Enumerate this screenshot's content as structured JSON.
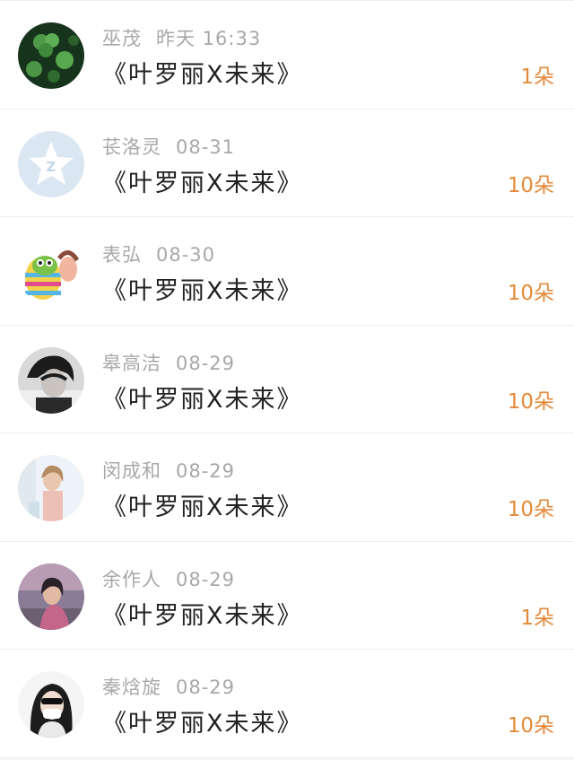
{
  "colors": {
    "count_accent": "#e38a3a",
    "meta_text": "#a8a8a8",
    "title_text": "#222222"
  },
  "entries": [
    {
      "name": "巫茂",
      "time": "昨天 16:33",
      "title": "《叶罗丽X未来》",
      "count": "1朵",
      "avatar": "clover-avatar"
    },
    {
      "name": "苌洛灵",
      "time": "08-31",
      "title": "《叶罗丽X未来》",
      "count": "10朵",
      "avatar": "qzone-star-avatar"
    },
    {
      "name": "表弘",
      "time": "08-30",
      "title": "《叶罗丽X未来》",
      "count": "10朵",
      "avatar": "cartoon-avatar"
    },
    {
      "name": "皋高洁",
      "time": "08-29",
      "title": "《叶罗丽X未来》",
      "count": "10朵",
      "avatar": "person-bw-avatar"
    },
    {
      "name": "闵成和",
      "time": "08-29",
      "title": "《叶罗丽X未来》",
      "count": "10朵",
      "avatar": "person-light-avatar"
    },
    {
      "name": "余作人",
      "time": "08-29",
      "title": "《叶罗丽X未来》",
      "count": "1朵",
      "avatar": "person-dusk-avatar"
    },
    {
      "name": "秦焓旋",
      "time": "08-29",
      "title": "《叶罗丽X未来》",
      "count": "10朵",
      "avatar": "person-mask-avatar"
    }
  ]
}
